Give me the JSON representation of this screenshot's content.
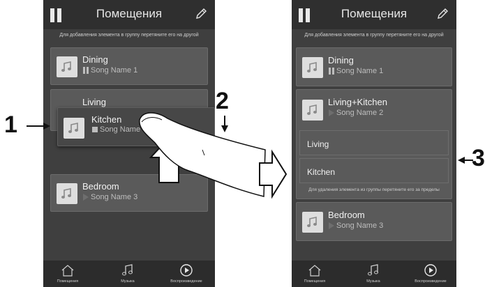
{
  "header": {
    "title": "Помещения"
  },
  "hints": {
    "add": "Для добавления элемента в группу перетяните его на другой",
    "remove": "Для удаления элемента из группы перетяните его за пределы"
  },
  "left": {
    "rooms": [
      {
        "room": "Dining",
        "song": "Song Name 1"
      },
      {
        "room": "Living"
      },
      {
        "room": "Kitchen",
        "song": "Song Name"
      },
      {
        "room": "Bedroom",
        "song": "Song Name 3"
      }
    ]
  },
  "right": {
    "rooms": [
      {
        "room": "Dining",
        "song": "Song Name 1"
      },
      {
        "room": "Living+Kitchen",
        "song": "Song Name 2"
      },
      {
        "room": "Bedroom",
        "song": "Song Name 3"
      }
    ],
    "group_members": [
      "Living",
      "Kitchen"
    ]
  },
  "nav": {
    "rooms": "Помещения",
    "music": "Музыка",
    "playback": "Воспроизведение"
  },
  "callouts": {
    "one": "1",
    "two": "2",
    "three": "3"
  },
  "icons": [
    "pause-icon",
    "pencil-icon",
    "music-note-icon",
    "house-icon",
    "play-circle-icon"
  ]
}
